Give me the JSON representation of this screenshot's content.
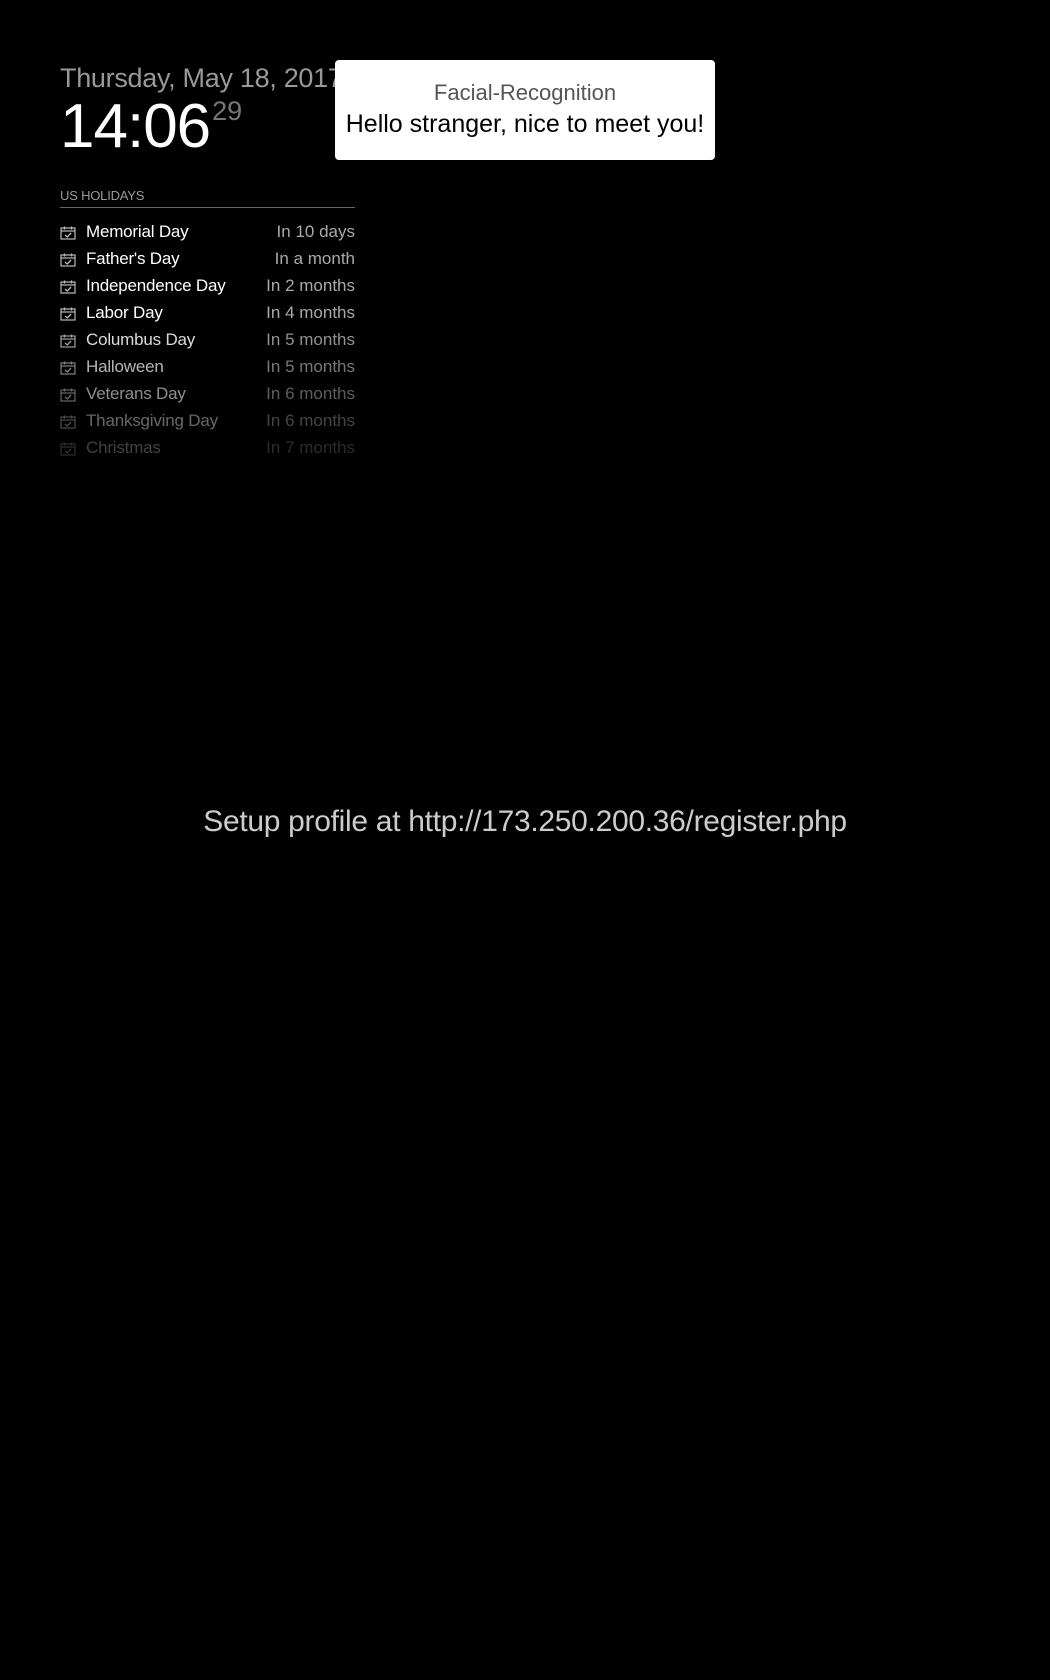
{
  "clock": {
    "date": "Thursday, May 18, 2017",
    "time": "14:06",
    "seconds": "29"
  },
  "calendar": {
    "header": "US HOLIDAYS",
    "icon": "calendar-check-icon",
    "events": [
      {
        "title": "Memorial Day",
        "time": "In 10 days",
        "opacity": 1.0
      },
      {
        "title": "Father's Day",
        "time": "In a month",
        "opacity": 1.0
      },
      {
        "title": "Independence Day",
        "time": "In 2 months",
        "opacity": 1.0
      },
      {
        "title": "Labor Day",
        "time": "In 4 months",
        "opacity": 1.0
      },
      {
        "title": "Columbus Day",
        "time": "In 5 months",
        "opacity": 0.85
      },
      {
        "title": "Halloween",
        "time": "In 5 months",
        "opacity": 0.7
      },
      {
        "title": "Veterans Day",
        "time": "In 6 months",
        "opacity": 0.55
      },
      {
        "title": "Thanksgiving Day",
        "time": "In 6 months",
        "opacity": 0.4
      },
      {
        "title": "Christmas",
        "time": "In 7 months",
        "opacity": 0.25
      }
    ]
  },
  "notification": {
    "title": "Facial-Recognition",
    "message": "Hello stranger, nice to meet you!"
  },
  "setup": {
    "message": "Setup profile at http://173.250.200.36/register.php"
  },
  "colors": {
    "background": "#000000",
    "primary_text": "#ffffff",
    "secondary_text": "#aaaaaa"
  }
}
